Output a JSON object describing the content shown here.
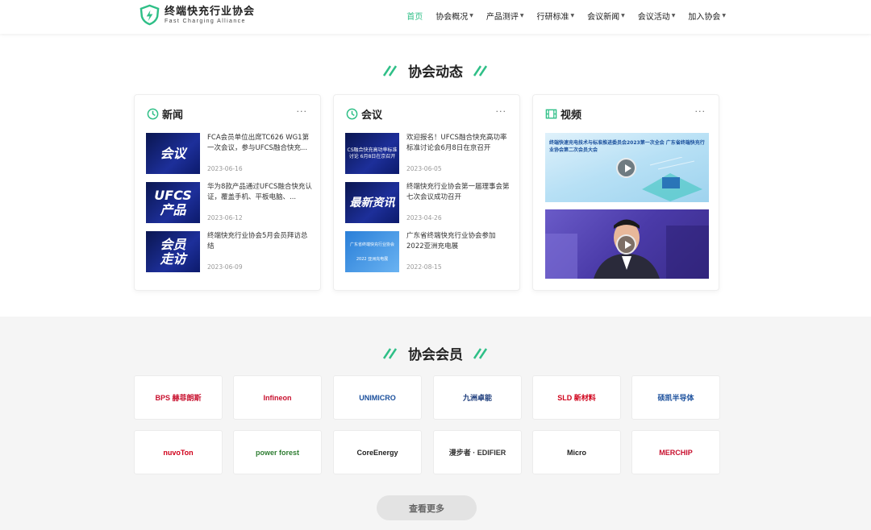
{
  "brand": {
    "name_cn": "终端快充行业协会",
    "name_en": "Fast Charging Alliance"
  },
  "nav": {
    "items": [
      {
        "label": "首页",
        "active": true
      },
      {
        "label": "协会概况"
      },
      {
        "label": "产品测评"
      },
      {
        "label": "行研标准"
      },
      {
        "label": "会议新闻"
      },
      {
        "label": "会议活动"
      },
      {
        "label": "加入协会"
      }
    ]
  },
  "dynamics": {
    "title": "协会动态",
    "news": {
      "title": "新闻",
      "more": "···",
      "items": [
        {
          "thumb": "会议",
          "title": "FCA会员单位出席TC626 WG1第一次会议，参与UFCS融合快充...",
          "date": "2023-06-16"
        },
        {
          "thumb": "UFCS 产品",
          "title": "华为8款产品通过UFCS融合快充认证，覆盖手机、平板电脑、...",
          "date": "2023-06-12"
        },
        {
          "thumb": "会员 走访",
          "title": "终端快充行业协会5月会员拜访总结",
          "date": "2023-06-09"
        }
      ]
    },
    "meetings": {
      "title": "会议",
      "more": "···",
      "items": [
        {
          "thumb": "CS融合快充高功率标准讨论 6月8日在京召开",
          "title": "欢迎报名！UFCS融合快充高功率标准讨论会6月8日在京召开",
          "date": "2023-06-05"
        },
        {
          "thumb": "最新资讯",
          "title": "终端快充行业协会第一届理事会第七次会议成功召开",
          "date": "2023-04-26"
        },
        {
          "thumb": "广东省终端快充行业协会 2022 亚洲充电展",
          "title": "广东省终端快充行业协会参加2022亚洲充电展",
          "date": "2022-08-15"
        }
      ]
    },
    "videos": {
      "title": "视频",
      "more": "···",
      "items": [
        {
          "caption": "终端快速充电技术与标准推进委员会2023第一次全会 广东省终端快充行业协会第二次会员大会"
        },
        {
          "caption": ""
        }
      ]
    }
  },
  "members": {
    "title": "协会会员",
    "logos": [
      {
        "name": "BPS 赫菲朗斯",
        "color": "#c8102e"
      },
      {
        "name": "Infineon",
        "color": "#c8102e"
      },
      {
        "name": "UNIMICRO",
        "color": "#1a4f9c"
      },
      {
        "name": "九洲卓能",
        "color": "#1a3a7a"
      },
      {
        "name": "SLD 新材料",
        "color": "#d0021b"
      },
      {
        "name": "硕凯半导体",
        "color": "#1a4f9c"
      },
      {
        "name": "nuvoTon",
        "color": "#d0021b"
      },
      {
        "name": "power forest",
        "color": "#2e7d32"
      },
      {
        "name": "CoreEnergy",
        "color": "#222222"
      },
      {
        "name": "漫步者 · EDIFIER",
        "color": "#333333"
      },
      {
        "name": "Micro",
        "color": "#222222"
      },
      {
        "name": "MERCHIP",
        "color": "#c8102e"
      }
    ],
    "more_button": "查看更多"
  },
  "colors": {
    "accent": "#2fbf87",
    "dark": "#0b1a5e"
  }
}
